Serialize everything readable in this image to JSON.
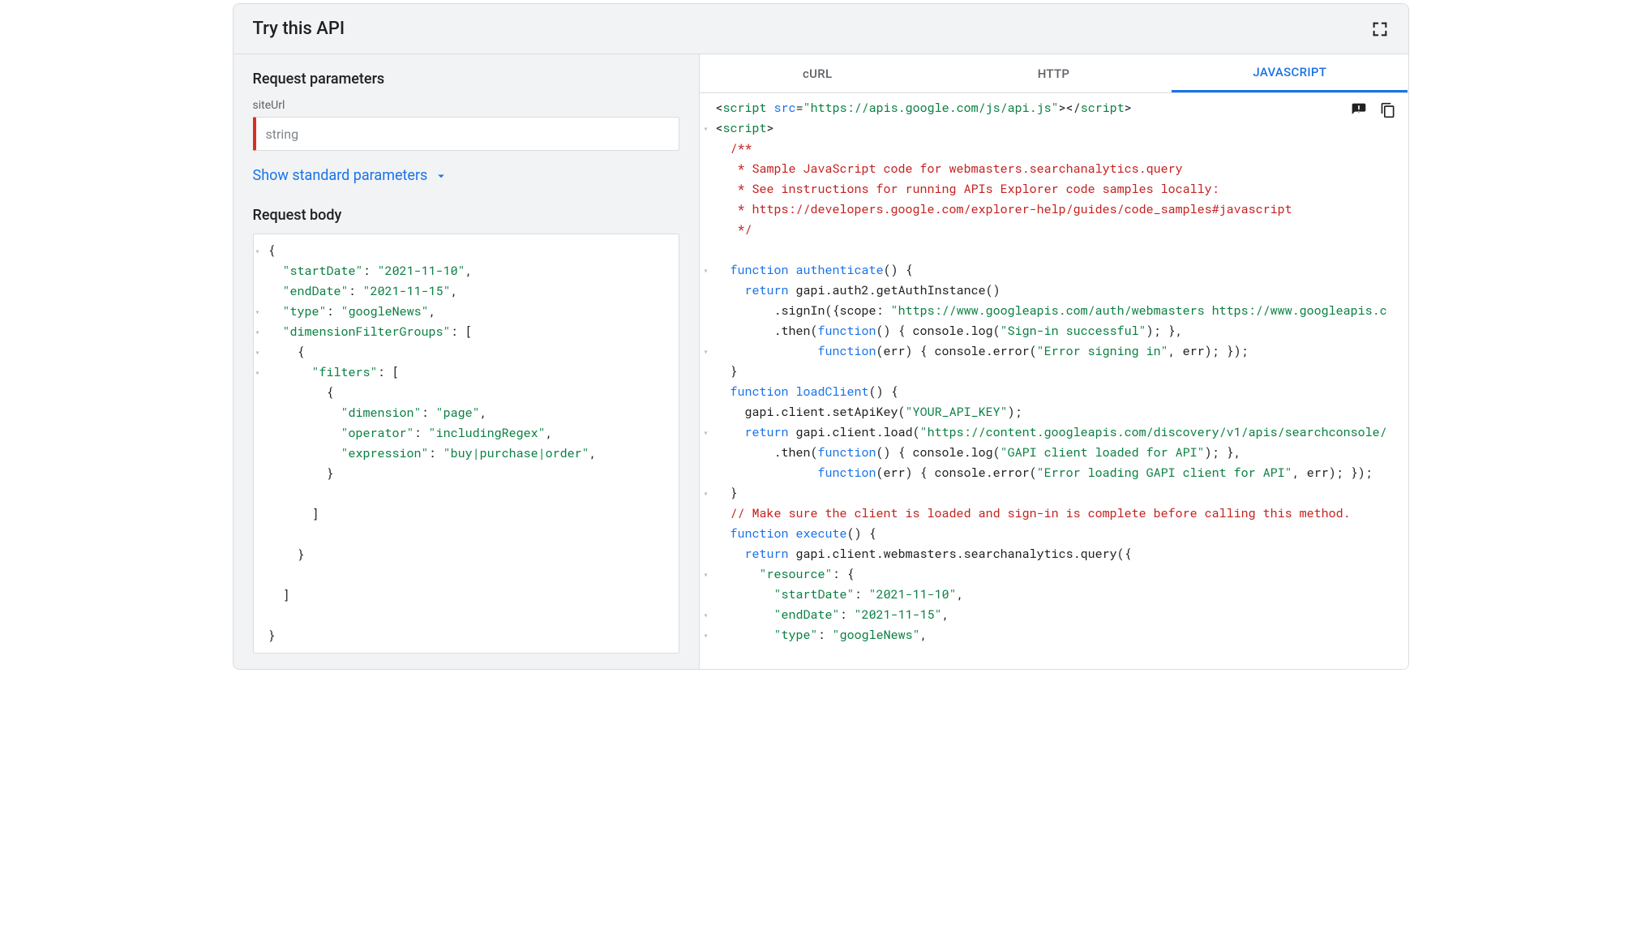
{
  "header": {
    "title": "Try this API"
  },
  "left": {
    "sectionTitle": "Request parameters",
    "params": {
      "siteUrl": {
        "label": "siteUrl",
        "placeholder": "string"
      }
    },
    "showStandard": "Show standard parameters",
    "requestBodyTitle": "Request body",
    "requestBody": {
      "startDate": "2021-11-10",
      "endDate": "2021-11-15",
      "type": "googleNews",
      "dimensionFilterGroups": [
        {
          "filters": [
            {
              "dimension": "page",
              "operator": "includingRegex",
              "expression": "buy|purchase|order"
            }
          ]
        }
      ]
    }
  },
  "tabs": {
    "curl": "cURL",
    "http": "HTTP",
    "javascript": "JAVASCRIPT",
    "active": "javascript"
  },
  "code": {
    "scriptSrc": "https://apis.google.com/js/api.js",
    "commentHeader": [
      "/**",
      " * Sample JavaScript code for webmasters.searchanalytics.query",
      " * See instructions for running APIs Explorer code samples locally:",
      " * https://developers.google.com/explorer-help/guides/code_samples#javascript",
      " */"
    ],
    "scope": "https://www.googleapis.com/auth/webmasters https://www.googleapis.c",
    "signInSuccess": "Sign-in successful",
    "signInError": "Error signing in",
    "apiKey": "YOUR_API_KEY",
    "discovery": "https://content.googleapis.com/discovery/v1/apis/searchconsole/",
    "loadSuccess": "GAPI client loaded for API",
    "loadError": "Error loading GAPI client for API",
    "makeSureComment": "// Make sure the client is loaded and sign-in is complete before calling this method.",
    "resource": {
      "startDate": "2021-11-10",
      "endDate": "2021-11-15",
      "type": "googleNews"
    }
  }
}
